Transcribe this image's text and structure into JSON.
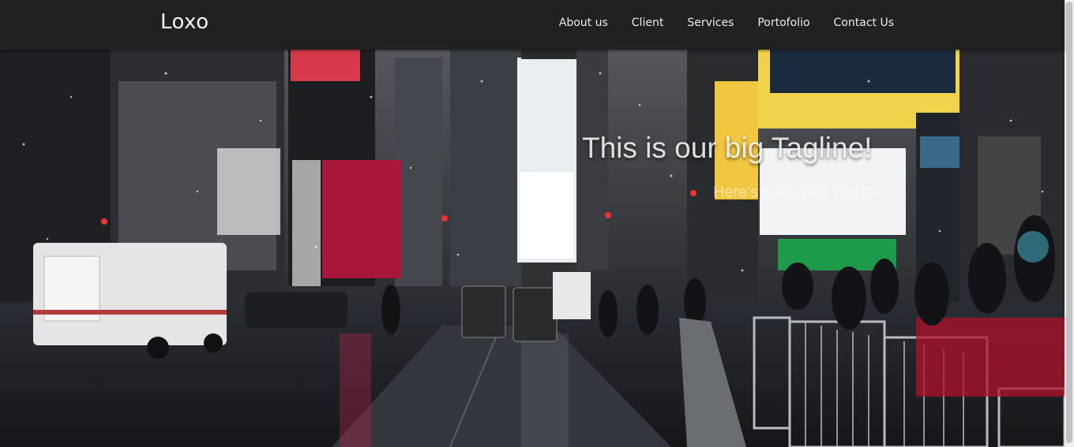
{
  "brand": "Loxo",
  "nav": [
    {
      "label": "About us"
    },
    {
      "label": "Client"
    },
    {
      "label": "Services"
    },
    {
      "label": "Portofolio"
    },
    {
      "label": "Contact Us"
    }
  ],
  "hero": {
    "tagline": "This is our big Tagline!",
    "slogan": "Here's our small slogan."
  },
  "colors": {
    "navbar": "#212121",
    "nav_text": "#ececec"
  }
}
